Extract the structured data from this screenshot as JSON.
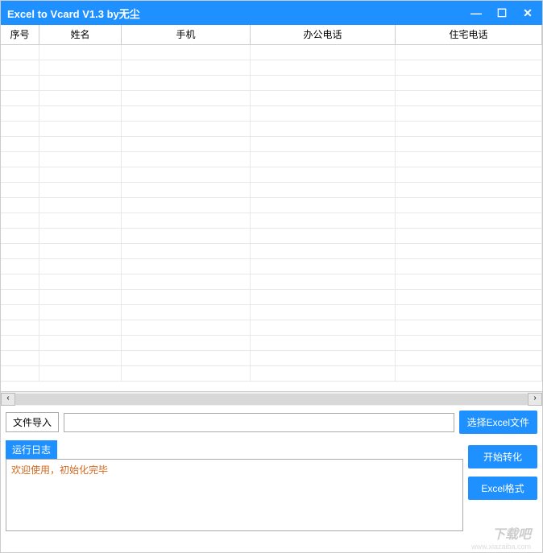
{
  "titlebar": {
    "title": "Excel to Vcard V1.3    by无尘"
  },
  "table": {
    "headers": {
      "seq": "序号",
      "name": "姓名",
      "mobile": "手机",
      "office": "办公电话",
      "home": "住宅电话"
    }
  },
  "controls": {
    "import_label": "文件导入",
    "file_value": "",
    "select_excel": "选择Excel文件",
    "log_label": "运行日志",
    "log_text": "欢迎使用，初始化完毕",
    "start_convert": "开始转化",
    "excel_format": "Excel格式"
  },
  "watermark": {
    "main": "下载吧",
    "sub": "www.xiazaiba.com"
  }
}
